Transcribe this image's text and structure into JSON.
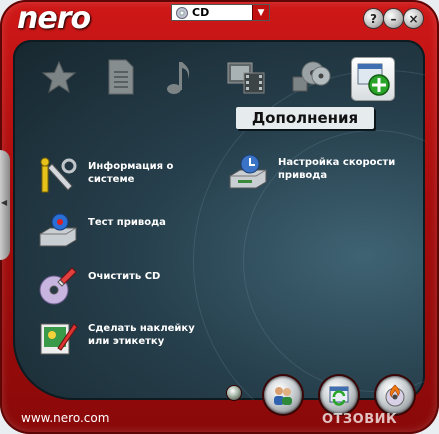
{
  "app": {
    "logo_text": "nero",
    "footer_url": "www.nero.com",
    "watermark": "ОТЗОВИК"
  },
  "drive_select": {
    "value": "CD"
  },
  "window_buttons": {
    "help": "?",
    "minimize": "–",
    "close": "×"
  },
  "categories": [
    {
      "name": "favorites",
      "icon": "star-icon"
    },
    {
      "name": "data",
      "icon": "document-icon"
    },
    {
      "name": "audio",
      "icon": "music-note-icon"
    },
    {
      "name": "photo-video",
      "icon": "film-strip-icon"
    },
    {
      "name": "copy-backup",
      "icon": "discs-icon"
    },
    {
      "name": "extras",
      "icon": "add-window-icon",
      "active": true
    }
  ],
  "active_category_title": "Дополнения",
  "items": {
    "system_info": "Информация о системе",
    "drive_speed": "Настройка скорости привода",
    "drive_test": "Тест привода",
    "erase_cd": "Очистить CD",
    "label": "Сделать наклейку или этикетку"
  },
  "colors": {
    "frame": "#c01414",
    "panel": "#27404d",
    "accent_green": "#2aa52a"
  }
}
